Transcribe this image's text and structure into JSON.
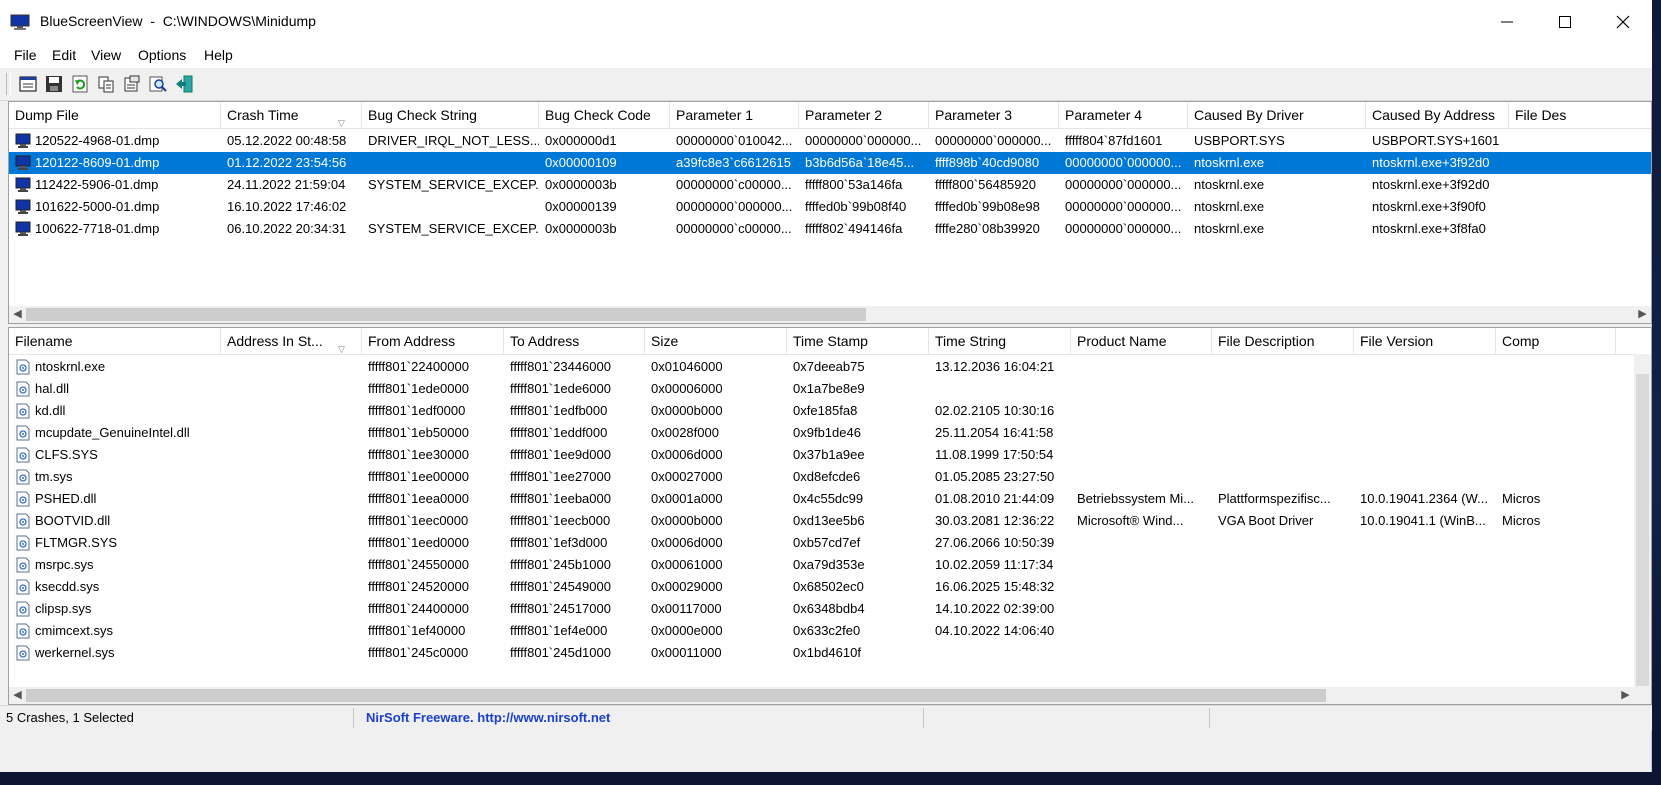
{
  "window": {
    "title": "BlueScreenView  -  C:\\WINDOWS\\Minidump"
  },
  "menu": [
    "File",
    "Edit",
    "View",
    "Options",
    "Help"
  ],
  "toolbar_icons": [
    "html-report-icon",
    "save-icon",
    "refresh-icon",
    "copy-icon",
    "properties-icon",
    "find-icon",
    "exit-icon"
  ],
  "crash_table": {
    "columns": [
      "Dump File",
      "Crash Time",
      "Bug Check String",
      "Bug Check Code",
      "Parameter 1",
      "Parameter 2",
      "Parameter 3",
      "Parameter 4",
      "Caused By Driver",
      "Caused By Address",
      "File Des"
    ],
    "sort_column": "Crash Time",
    "selected_row": 1,
    "rows": [
      [
        "120522-4968-01.dmp",
        "05.12.2022 00:48:58",
        "DRIVER_IRQL_NOT_LESS...",
        "0x000000d1",
        "00000000`010042...",
        "00000000`000000...",
        "00000000`000000...",
        "fffff804`87fd1601",
        "USBPORT.SYS",
        "USBPORT.SYS+1601",
        ""
      ],
      [
        "120122-8609-01.dmp",
        "01.12.2022 23:54:56",
        "",
        "0x00000109",
        "a39fc8e3`c6612615",
        "b3b6d56a`18e45...",
        "ffff898b`40cd9080",
        "00000000`000000...",
        "ntoskrnl.exe",
        "ntoskrnl.exe+3f92d0",
        ""
      ],
      [
        "112422-5906-01.dmp",
        "24.11.2022 21:59:04",
        "SYSTEM_SERVICE_EXCEP...",
        "0x0000003b",
        "00000000`c00000...",
        "fffff800`53a146fa",
        "fffff800`56485920",
        "00000000`000000...",
        "ntoskrnl.exe",
        "ntoskrnl.exe+3f92d0",
        ""
      ],
      [
        "101622-5000-01.dmp",
        "16.10.2022 17:46:02",
        "",
        "0x00000139",
        "00000000`000000...",
        "ffffed0b`99b08f40",
        "ffffed0b`99b08e98",
        "00000000`000000...",
        "ntoskrnl.exe",
        "ntoskrnl.exe+3f90f0",
        ""
      ],
      [
        "100622-7718-01.dmp",
        "06.10.2022 20:34:31",
        "SYSTEM_SERVICE_EXCEP...",
        "0x0000003b",
        "00000000`c00000...",
        "fffff802`494146fa",
        "ffffe280`08b39920",
        "00000000`000000...",
        "ntoskrnl.exe",
        "ntoskrnl.exe+3f8fa0",
        ""
      ]
    ]
  },
  "driver_table": {
    "columns": [
      "Filename",
      "Address In St...",
      "From Address",
      "To Address",
      "Size",
      "Time Stamp",
      "Time String",
      "Product Name",
      "File Description",
      "File Version",
      "Comp"
    ],
    "sort_column": "Address In St...",
    "rows": [
      [
        "ntoskrnl.exe",
        "",
        "fffff801`22400000",
        "fffff801`23446000",
        "0x01046000",
        "0x7deeab75",
        "13.12.2036 16:04:21",
        "",
        "",
        "",
        ""
      ],
      [
        "hal.dll",
        "",
        "fffff801`1ede0000",
        "fffff801`1ede6000",
        "0x00006000",
        "0x1a7be8e9",
        "",
        "",
        "",
        "",
        ""
      ],
      [
        "kd.dll",
        "",
        "fffff801`1edf0000",
        "fffff801`1edfb000",
        "0x0000b000",
        "0xfe185fa8",
        "02.02.2105 10:30:16",
        "",
        "",
        "",
        ""
      ],
      [
        "mcupdate_GenuineIntel.dll",
        "",
        "fffff801`1eb50000",
        "fffff801`1eddf000",
        "0x0028f000",
        "0x9fb1de46",
        "25.11.2054 16:41:58",
        "",
        "",
        "",
        ""
      ],
      [
        "CLFS.SYS",
        "",
        "fffff801`1ee30000",
        "fffff801`1ee9d000",
        "0x0006d000",
        "0x37b1a9ee",
        "11.08.1999 17:50:54",
        "",
        "",
        "",
        ""
      ],
      [
        "tm.sys",
        "",
        "fffff801`1ee00000",
        "fffff801`1ee27000",
        "0x00027000",
        "0xd8efcde6",
        "01.05.2085 23:27:50",
        "",
        "",
        "",
        ""
      ],
      [
        "PSHED.dll",
        "",
        "fffff801`1eea0000",
        "fffff801`1eeba000",
        "0x0001a000",
        "0x4c55dc99",
        "01.08.2010 21:44:09",
        "Betriebssystem Mi...",
        "Plattformspezifisc...",
        "10.0.19041.2364 (W...",
        "Micros"
      ],
      [
        "BOOTVID.dll",
        "",
        "fffff801`1eec0000",
        "fffff801`1eecb000",
        "0x0000b000",
        "0xd13ee5b6",
        "30.03.2081 12:36:22",
        "Microsoft® Wind...",
        "VGA Boot Driver",
        "10.0.19041.1 (WinB...",
        "Micros"
      ],
      [
        "FLTMGR.SYS",
        "",
        "fffff801`1eed0000",
        "fffff801`1ef3d000",
        "0x0006d000",
        "0xb57cd7ef",
        "27.06.2066 10:50:39",
        "",
        "",
        "",
        ""
      ],
      [
        "msrpc.sys",
        "",
        "fffff801`24550000",
        "fffff801`245b1000",
        "0x00061000",
        "0xa79d353e",
        "10.02.2059 11:17:34",
        "",
        "",
        "",
        ""
      ],
      [
        "ksecdd.sys",
        "",
        "fffff801`24520000",
        "fffff801`24549000",
        "0x00029000",
        "0x68502ec0",
        "16.06.2025 15:48:32",
        "",
        "",
        "",
        ""
      ],
      [
        "clipsp.sys",
        "",
        "fffff801`24400000",
        "fffff801`24517000",
        "0x00117000",
        "0x6348bdb4",
        "14.10.2022 02:39:00",
        "",
        "",
        "",
        ""
      ],
      [
        "cmimcext.sys",
        "",
        "fffff801`1ef40000",
        "fffff801`1ef4e000",
        "0x0000e000",
        "0x633c2fe0",
        "04.10.2022 14:06:40",
        "",
        "",
        "",
        ""
      ],
      [
        "werkernel.sys",
        "",
        "fffff801`245c0000",
        "fffff801`245d1000",
        "0x00011000",
        "0x1bd4610f",
        "",
        "",
        "",
        "",
        ""
      ]
    ]
  },
  "statusbar": {
    "summary": "5 Crashes, 1 Selected",
    "link": "NirSoft Freeware.  http://www.nirsoft.net"
  },
  "colors": {
    "selection": "#0078d7",
    "link": "#1a3fd1"
  }
}
